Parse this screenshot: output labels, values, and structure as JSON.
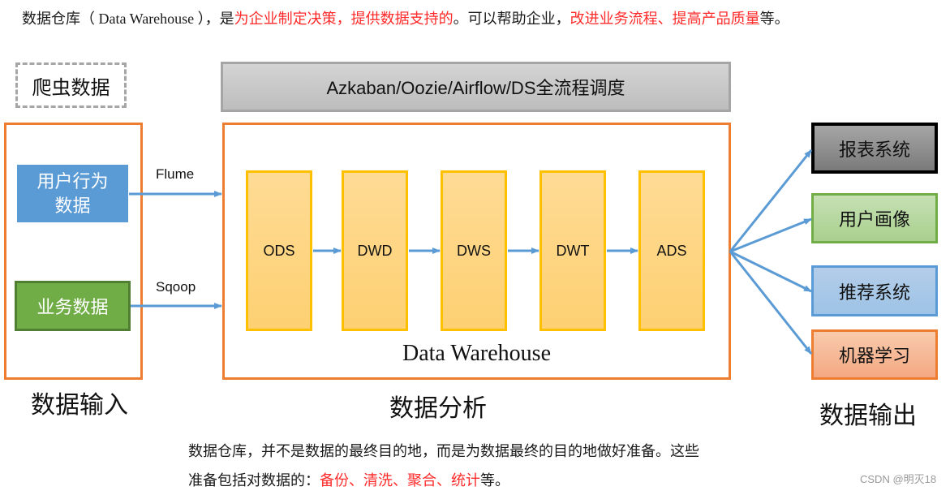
{
  "intro": {
    "segments": [
      {
        "text": "数据仓库（ Data Warehouse ），是",
        "highlight": false
      },
      {
        "text": "为企业制定决策，提供数据支持的",
        "highlight": true
      },
      {
        "text": "。可以帮助企业，",
        "highlight": false
      },
      {
        "text": "改进业务流程、提高产品质量",
        "highlight": true
      },
      {
        "text": "等。",
        "highlight": false
      }
    ]
  },
  "colors": {
    "highlight": "#ff2a2a",
    "frame": "#ed7d31",
    "arrow": "#5b9bd5",
    "layer_border": "#ffc000"
  },
  "inputs": {
    "crawler": "爬虫数据",
    "user_behavior": "用户行为\n数据",
    "business": "业务数据",
    "section_title": "数据输入"
  },
  "flows": {
    "flume": "Flume",
    "sqoop": "Sqoop"
  },
  "scheduler": "Azkaban/Oozie/Airflow/DS全流程调度",
  "warehouse": {
    "layers": [
      "ODS",
      "DWD",
      "DWS",
      "DWT",
      "ADS"
    ],
    "label": "Data Warehouse",
    "section_title": "数据分析"
  },
  "outputs": {
    "items": [
      "报表系统",
      "用户画像",
      "推荐系统",
      "机器学习"
    ],
    "section_title": "数据输出"
  },
  "note": {
    "line1": "数据仓库，并不是数据的最终目的地，而是为数据最终的目的地做好准备。这些",
    "line2_segments": [
      {
        "text": "准备包括对数据的：",
        "highlight": false
      },
      {
        "text": "备份、清洗、聚合、统计",
        "highlight": true
      },
      {
        "text": "等。",
        "highlight": false
      }
    ]
  },
  "watermark": "CSDN @明灭18"
}
